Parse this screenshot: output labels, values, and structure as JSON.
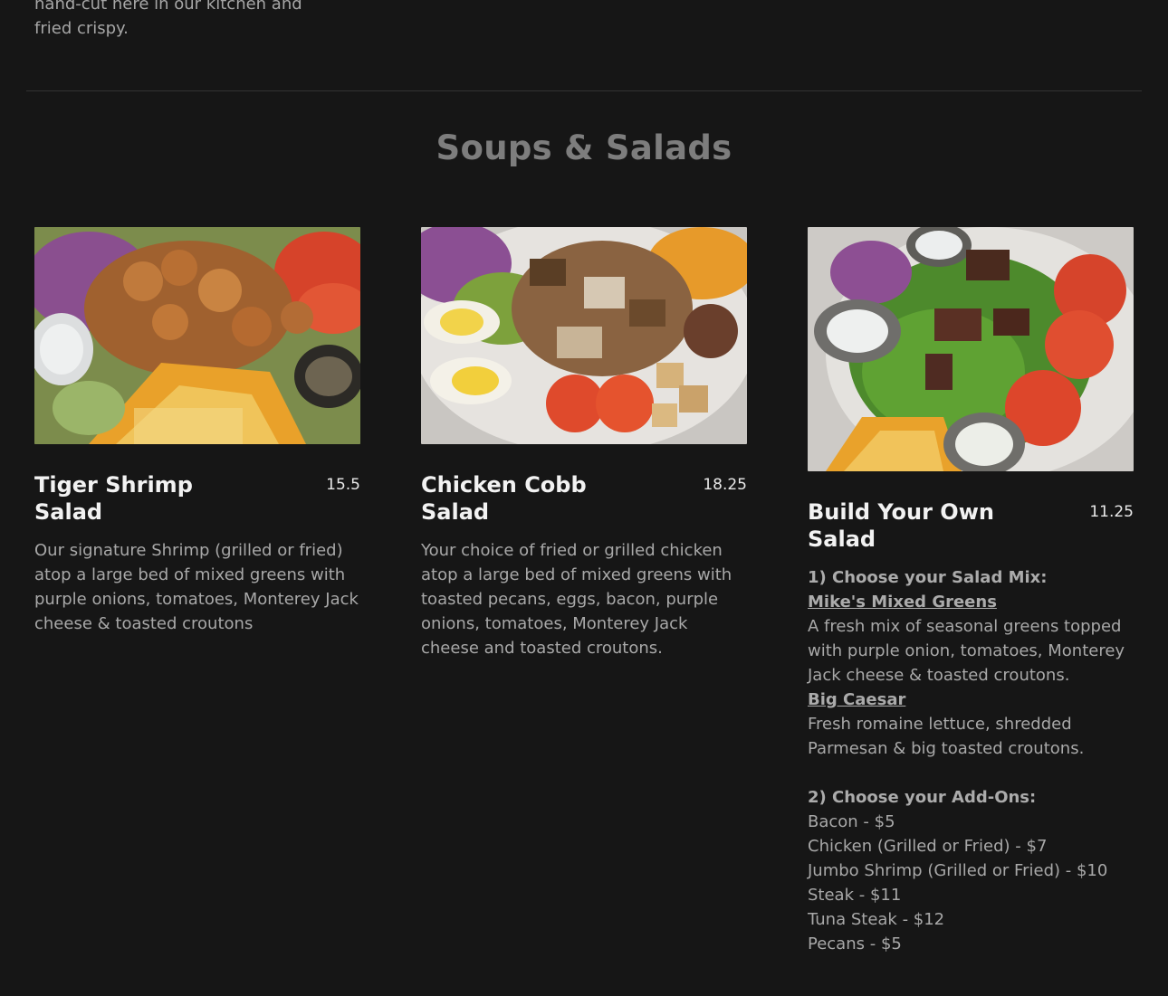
{
  "previous_item": {
    "description_tail": "hand-cut here in our kitchen and fried crispy."
  },
  "section": {
    "title": "Soups & Salads"
  },
  "items": [
    {
      "name": "Tiger Shrimp Salad",
      "price": "15.5",
      "description": "Our signature Shrimp (grilled or fried) atop a large bed of mixed greens with purple onions, tomatoes, Monterey Jack cheese & toasted croutons"
    },
    {
      "name": "Chicken Cobb Salad",
      "price": "18.25",
      "description": "Your choice of fried or grilled chicken atop a large bed of mixed greens with toasted pecans, eggs, bacon, purple onions, tomatoes, Monterey Jack cheese and toasted croutons."
    },
    {
      "name": "Build Your Own Salad",
      "price": "11.25",
      "step1_heading": "1) Choose your Salad Mix:",
      "mix1_name": "Mike's Mixed Greens ",
      "mix1_desc": "A fresh mix of seasonal greens topped with purple onion, tomatoes, Monterey Jack cheese & toasted croutons.",
      "mix2_name": "Big Caesar ",
      "mix2_desc": "Fresh romaine lettuce, shredded Parmesan & big toasted croutons.",
      "step2_heading": "2) Choose your Add-Ons:",
      "addons": [
        "Bacon - $5",
        "Chicken (Grilled or Fried) - $7",
        "Jumbo Shrimp (Grilled or Fried) - $10",
        "Steak - $11",
        "Tuna Steak - $12",
        "Pecans - $5"
      ]
    }
  ],
  "colors": {
    "background": "#161616",
    "title": "#7d7d7d",
    "heading": "#f2f2f2",
    "body_text": "#a8a8a8",
    "divider": "#333333"
  }
}
